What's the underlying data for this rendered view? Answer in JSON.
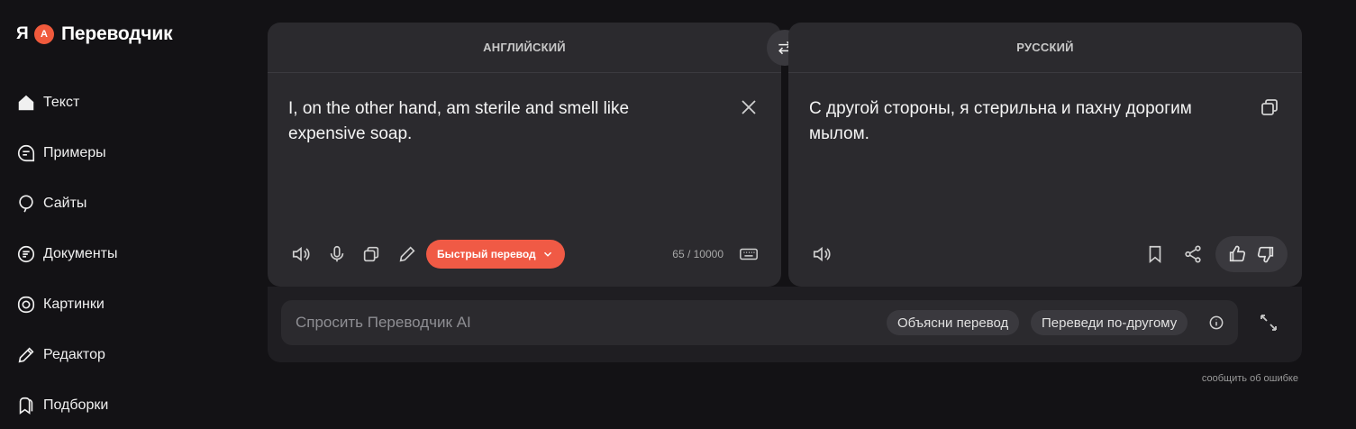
{
  "app": {
    "logo_letter": "Я",
    "logo_badge": "А",
    "title": "Переводчик"
  },
  "sidebar": {
    "items": [
      {
        "label": "Текст",
        "icon": "home-icon",
        "active": true
      },
      {
        "label": "Примеры",
        "icon": "chat-bubble-icon"
      },
      {
        "label": "Сайты",
        "icon": "globe-pin-icon"
      },
      {
        "label": "Документы",
        "icon": "document-icon"
      },
      {
        "label": "Картинки",
        "icon": "camera-icon"
      },
      {
        "label": "Редактор",
        "icon": "pen-icon"
      },
      {
        "label": "Подборки",
        "icon": "bookmark-folder-icon"
      }
    ]
  },
  "source": {
    "language": "АНГЛИЙСКИЙ",
    "text": " I, on the other hand, am sterile and smell like expensive soap.",
    "counter": "65 / 10000",
    "fast_translate_label": "Быстрый перевод"
  },
  "target": {
    "language": "РУССКИЙ",
    "text": "С другой стороны, я стерильна и пахну дорогим мылом."
  },
  "ai": {
    "placeholder": "Спросить Переводчик AI",
    "chip_explain": "Объясни перевод",
    "chip_rephrase": "Переведи по-другому"
  },
  "report_label": "сообщить об ошибке",
  "colors": {
    "accent": "#f05a45",
    "background": "#131215",
    "panel": "#2b2a2e"
  }
}
